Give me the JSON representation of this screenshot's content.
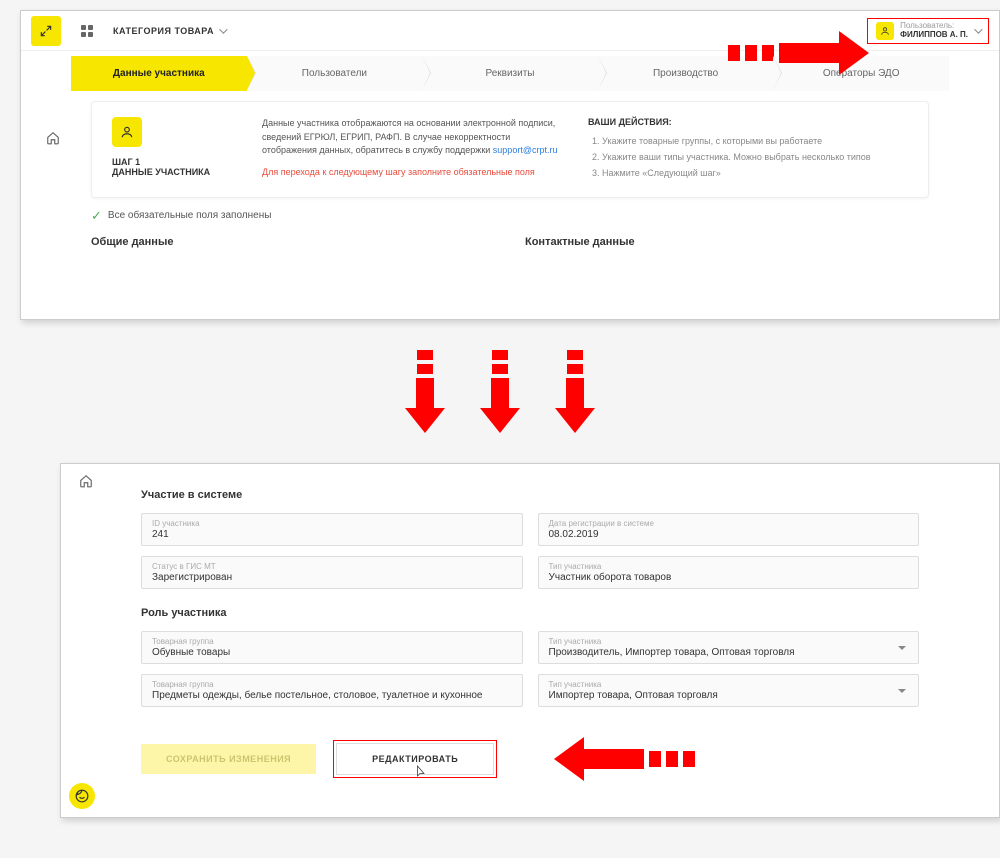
{
  "header": {
    "category_label": "КАТЕГОРИЯ ТОВАРА",
    "user_label": "Пользователь:",
    "user_name": "ФИЛИППОВ А. П."
  },
  "tabs": [
    {
      "label": "Данные участника",
      "active": true
    },
    {
      "label": "Пользователи",
      "active": false
    },
    {
      "label": "Реквизиты",
      "active": false
    },
    {
      "label": "Производство",
      "active": false
    },
    {
      "label": "Операторы ЭДО",
      "active": false
    }
  ],
  "step": {
    "num": "ШАГ 1",
    "title": "ДАННЫЕ УЧАСТНИКА",
    "info_text": "Данные участника отображаются на основании электронной подписи, сведений ЕГРЮЛ, ЕГРИП, РАФП. В случае некорректности отображения данных, обратитесь в службу поддержки ",
    "support_link": "support@crpt.ru",
    "warn_text": "Для перехода к следующему шагу заполните обязательные поля",
    "actions_title": "ВАШИ ДЕЙСТВИЯ:",
    "actions": [
      "Укажите товарные группы, с которыми вы работаете",
      "Укажите ваши типы участника. Можно выбрать несколько типов",
      "Нажмите «Следующий шаг»"
    ]
  },
  "status_text": "Все обязательные поля заполнены",
  "sections_top": {
    "general": "Общие данные",
    "contact": "Контактные данные"
  },
  "bottom": {
    "system_title": "Участие в системе",
    "role_title": "Роль участника",
    "fields": {
      "id_label": "ID участника",
      "id_value": "241",
      "date_label": "Дата регистрации в системе",
      "date_value": "08.02.2019",
      "status_label": "Статус в ГИС МТ",
      "status_value": "Зарегистрирован",
      "type_label": "Тип участника",
      "type_value": "Участник оборота товаров",
      "group1_label": "Товарная группа",
      "group1_value": "Обувные товары",
      "role1_label": "Тип участника",
      "role1_value": "Производитель, Импортер товара, Оптовая торговля",
      "group2_label": "Товарная группа",
      "group2_value": "Предметы одежды, белье постельное, столовое, туалетное и кухонное",
      "role2_label": "Тип участника",
      "role2_value": "Импортер товара, Оптовая торговля"
    },
    "buttons": {
      "save": "СОХРАНИТЬ ИЗМЕНЕНИЯ",
      "edit": "РЕДАКТИРОВАТЬ"
    }
  }
}
